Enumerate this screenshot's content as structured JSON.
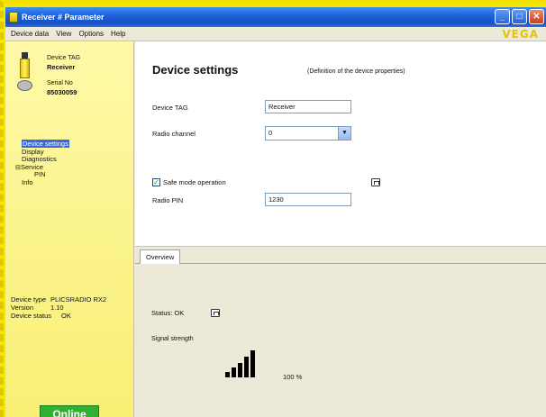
{
  "window": {
    "title": "Receiver # Parameter",
    "buttons": {
      "minimize": "_",
      "maximize": "□",
      "close": "✕"
    }
  },
  "menu": {
    "items": [
      "Device data",
      "View",
      "Options",
      "Help"
    ],
    "brand": "VEGA"
  },
  "sidebar": {
    "tag_label": "Device TAG",
    "tag_value": "Receiver",
    "serial_label": "Serial No",
    "serial_value": "85030059",
    "nav": [
      {
        "label": "Device settings"
      },
      {
        "label": "Display"
      },
      {
        "label": "Diagnostics"
      },
      {
        "label": "Service",
        "expander": "⊟"
      },
      {
        "label": "PIN"
      },
      {
        "label": "Info"
      }
    ],
    "device_type_label": "Device type",
    "device_type_value": "PLICSRADIO RX2",
    "version_label": "Version",
    "version_value": "1.10",
    "device_status_label": "Device status",
    "device_status_value": "OK",
    "connection_state": "Online",
    "colors": {
      "online": "#2fb030",
      "panel": "#fff9a8",
      "accent": "#f2e100"
    }
  },
  "settings": {
    "title": "Device settings",
    "description": "(Definition of the device properties)",
    "device_tag_label": "Device TAG",
    "device_tag_value": "Receiver",
    "radio_channel_label": "Radio channel",
    "radio_channel_value": "0",
    "safe_mode_label": "Safe mode operation",
    "safe_mode_checked": "✓",
    "radio_pin_label": "Radio PIN",
    "radio_pin_value": "1230"
  },
  "overview": {
    "tab_label": "Overview",
    "status_text": "Status: OK",
    "signal_label": "Signal strength",
    "signal_value": "100 %",
    "signal_level_fraction": 1.0
  }
}
